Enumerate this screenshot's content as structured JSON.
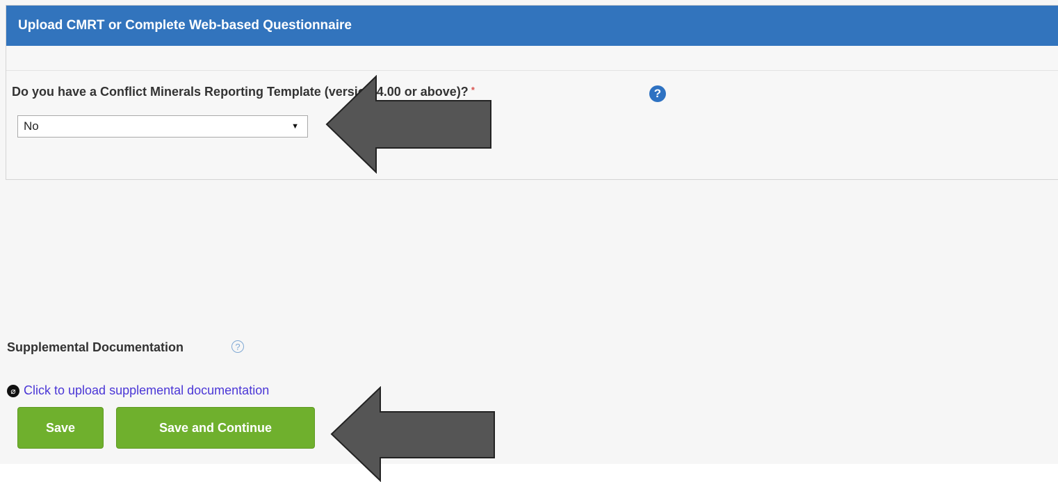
{
  "panel": {
    "title": "Upload CMRT or Complete Web-based Questionnaire",
    "question": "Do you have a Conflict Minerals Reporting Template (version 4.00 or above)?",
    "required_marker": "*",
    "help_icon": "question-circle-icon",
    "help_glyph": "?",
    "select": {
      "value": "No",
      "caret_icon": "caret-down-icon",
      "caret": "▼"
    }
  },
  "supplemental": {
    "label": "Supplemental Documentation",
    "help_icon": "question-circle-outline-icon",
    "help_glyph": "?",
    "upload_link": "Click to upload supplemental documentation",
    "clip_icon": "paperclip-icon",
    "clip_glyph": "⌀"
  },
  "buttons": {
    "save": "Save",
    "save_continue": "Save and Continue"
  },
  "colors": {
    "header_blue": "#3274bd",
    "button_green": "#6fb02d",
    "arrow_gray": "#555555",
    "link_purple": "#4a36d6",
    "required_red": "#d9534f"
  }
}
